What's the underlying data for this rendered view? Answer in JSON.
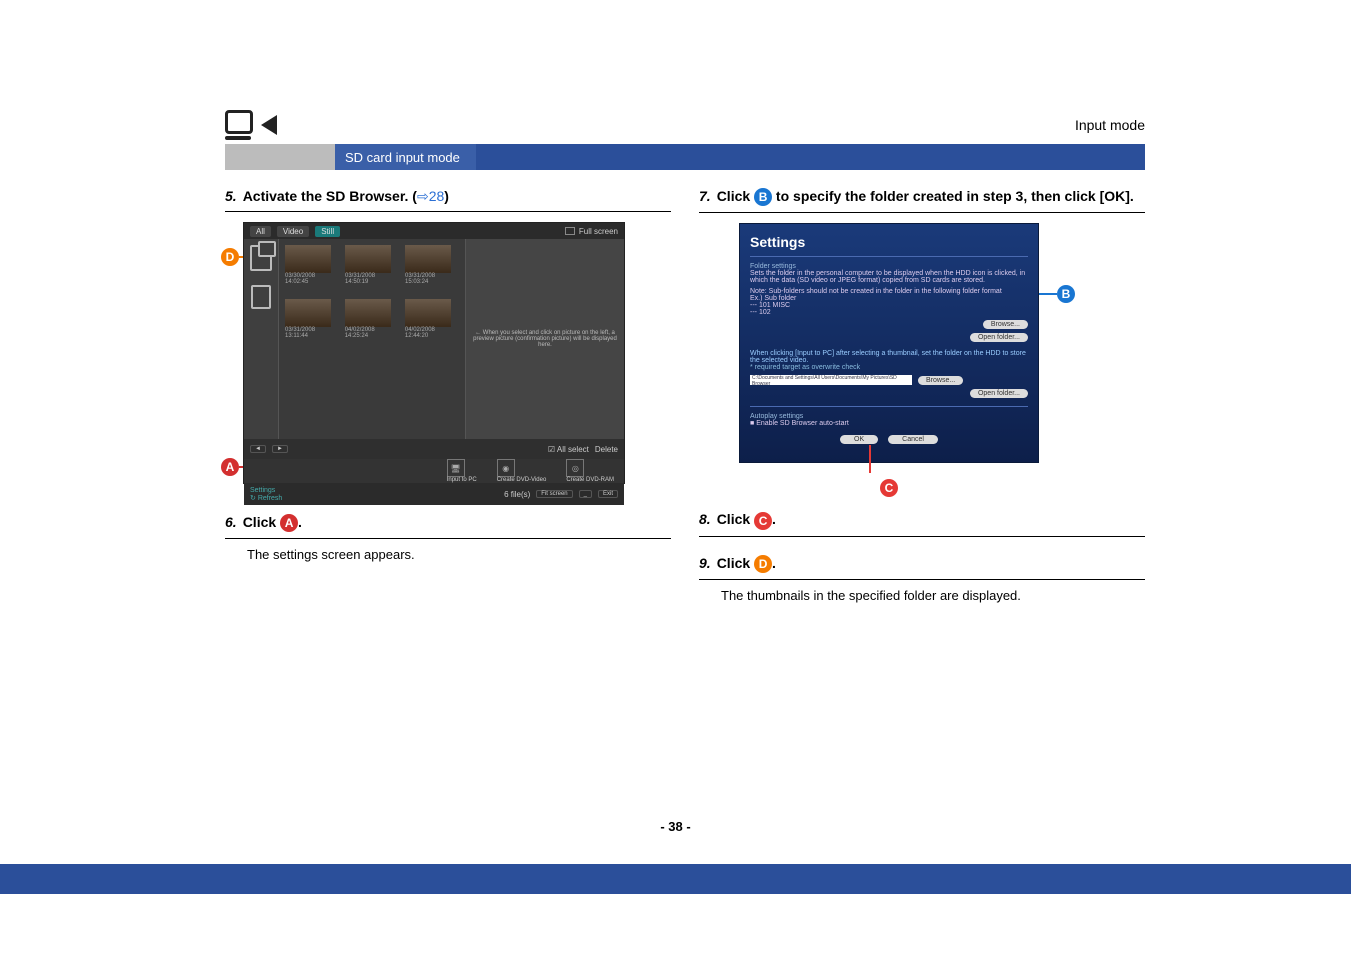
{
  "header": {
    "mode_label": "Input mode",
    "section_title": "SD card input mode"
  },
  "left": {
    "step5": {
      "num": "5.",
      "text": "Activate the SD Browser. (",
      "link_arrow": "⇨",
      "link": "28",
      "text_end": ")"
    },
    "step6": {
      "num": "6.",
      "text_pre": "Click ",
      "text_post": ".",
      "desc": "The settings screen appears."
    },
    "browser": {
      "tab_all": "All",
      "tab_video": "Video",
      "tab_still": "Still",
      "full_screen": "Full screen",
      "thumb_dates": [
        "03/30/2008 14:02:45",
        "03/31/2008 14:50:19",
        "03/31/2008 15:03:24",
        "03/31/2008 13:11:44",
        "04/02/2008 14:25:24",
        "04/02/2008 12:44:20"
      ],
      "preview_hint": "← When you select and click on picture on the left, a preview picture (confirmation picture) will be displayed here.",
      "all_select": "All select",
      "delete": "Delete",
      "input_pc": "Input to PC",
      "create_dvd_video": "Create DVD-Video",
      "create_dvd_ram": "Create DVD-RAM",
      "settings": "Settings",
      "refresh": "Refresh",
      "items": "6 file(s)",
      "fit_screen": "Fit screen",
      "exit": "Exit"
    }
  },
  "right": {
    "step7": {
      "num": "7.",
      "text_pre": "Click ",
      "text_post": " to specify the folder created in step 3, then click [OK]."
    },
    "step8": {
      "num": "8.",
      "text_pre": "Click ",
      "text_post": "."
    },
    "step9": {
      "num": "9.",
      "text_pre": "Click ",
      "text_post": ".",
      "desc": "The thumbnails in the specified folder are displayed."
    },
    "settings": {
      "title": "Settings",
      "folder_heading": "Folder settings",
      "desc1": "Sets the folder in the personal computer to be displayed when the HDD icon is clicked, in which the data (SD video or JPEG format) copied from SD cards are stored.",
      "note": "Note: Sub-folders should not be created in the folder in the following folder format\n    Ex.) Sub folder\n         --- 101 MISC\n         --- 102",
      "browse": "Browse...",
      "open_folder": "Open folder...",
      "desc2": "When clicking [Input to PC] after selecting a thumbnail, set the folder on the HDD to store the selected video.",
      "desc3": "* required target as overwrite check",
      "path_example": "C:\\Documents and Settings\\All Users\\Documents\\My Pictures\\SD Browser",
      "autoplay_heading": "Autoplay settings",
      "autoplay_check": "Enable SD Browser auto-start",
      "ok": "OK",
      "cancel": "Cancel"
    }
  },
  "circles": {
    "A": "A",
    "B": "B",
    "C": "C",
    "D": "D"
  },
  "footer": {
    "page": "- 38 -"
  }
}
